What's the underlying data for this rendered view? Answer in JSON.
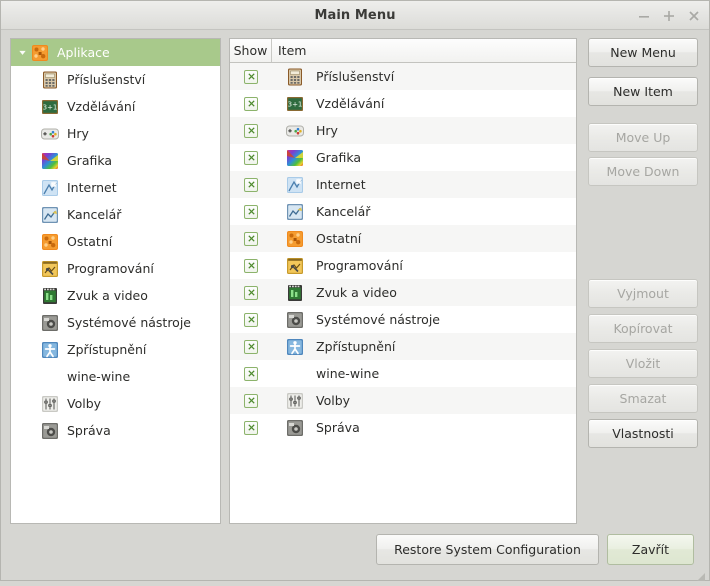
{
  "window": {
    "title": "Main Menu",
    "controls": [
      {
        "name": "minimize",
        "glyph": "minimize-icon"
      },
      {
        "name": "maximize",
        "glyph": "maximize-icon"
      },
      {
        "name": "close",
        "glyph": "close-icon"
      }
    ]
  },
  "tree": {
    "root": {
      "label": "Aplikace",
      "icon": "applications-other-icon",
      "expanded": true,
      "selected": true
    },
    "items": [
      {
        "label": "Příslušenství",
        "icon": "accessories-icon"
      },
      {
        "label": "Vzdělávání",
        "icon": "education-icon"
      },
      {
        "label": "Hry",
        "icon": "games-icon"
      },
      {
        "label": "Grafika",
        "icon": "graphics-icon"
      },
      {
        "label": "Internet",
        "icon": "internet-icon"
      },
      {
        "label": "Kancelář",
        "icon": "office-icon"
      },
      {
        "label": "Ostatní",
        "icon": "other-icon"
      },
      {
        "label": "Programování",
        "icon": "development-icon"
      },
      {
        "label": "Zvuk a video",
        "icon": "multimedia-icon"
      },
      {
        "label": "Systémové nástroje",
        "icon": "system-tools-icon"
      },
      {
        "label": "Zpřístupnění",
        "icon": "accessibility-icon"
      },
      {
        "label": "wine-wine",
        "icon": "no-icon"
      },
      {
        "label": "Volby",
        "icon": "preferences-icon"
      },
      {
        "label": "Správa",
        "icon": "administration-icon"
      }
    ]
  },
  "list": {
    "columns": [
      "Show",
      "Item"
    ],
    "rows": [
      {
        "show": true,
        "label": "Příslušenství",
        "icon": "accessories-icon"
      },
      {
        "show": true,
        "label": "Vzdělávání",
        "icon": "education-icon"
      },
      {
        "show": true,
        "label": "Hry",
        "icon": "games-icon"
      },
      {
        "show": true,
        "label": "Grafika",
        "icon": "graphics-icon"
      },
      {
        "show": true,
        "label": "Internet",
        "icon": "internet-icon"
      },
      {
        "show": true,
        "label": "Kancelář",
        "icon": "office-icon"
      },
      {
        "show": true,
        "label": "Ostatní",
        "icon": "other-icon"
      },
      {
        "show": true,
        "label": "Programování",
        "icon": "development-icon"
      },
      {
        "show": true,
        "label": "Zvuk a video",
        "icon": "multimedia-icon"
      },
      {
        "show": true,
        "label": "Systémové nástroje",
        "icon": "system-tools-icon"
      },
      {
        "show": true,
        "label": "Zpřístupnění",
        "icon": "accessibility-icon"
      },
      {
        "show": true,
        "label": "wine-wine",
        "icon": "no-icon"
      },
      {
        "show": true,
        "label": "Volby",
        "icon": "preferences-icon"
      },
      {
        "show": true,
        "label": "Správa",
        "icon": "administration-icon"
      }
    ]
  },
  "side_buttons": [
    {
      "label": "New Menu",
      "enabled": true
    },
    {
      "label": "New Item",
      "enabled": true
    },
    {
      "label": "Move Up",
      "enabled": false
    },
    {
      "label": "Move Down",
      "enabled": false
    },
    {
      "label": "Vyjmout",
      "enabled": false
    },
    {
      "label": "Kopírovat",
      "enabled": false
    },
    {
      "label": "Vložit",
      "enabled": false
    },
    {
      "label": "Smazat",
      "enabled": false
    },
    {
      "label": "Vlastnosti",
      "enabled": true
    }
  ],
  "footer": {
    "restore_label": "Restore System Configuration",
    "close_label": "Zavřít"
  },
  "colors": {
    "selection": "#a8c98b",
    "window_bg": "#d6d6d2",
    "checkbox_border": "#8cb36b",
    "default_button": "#e1e9d5"
  }
}
